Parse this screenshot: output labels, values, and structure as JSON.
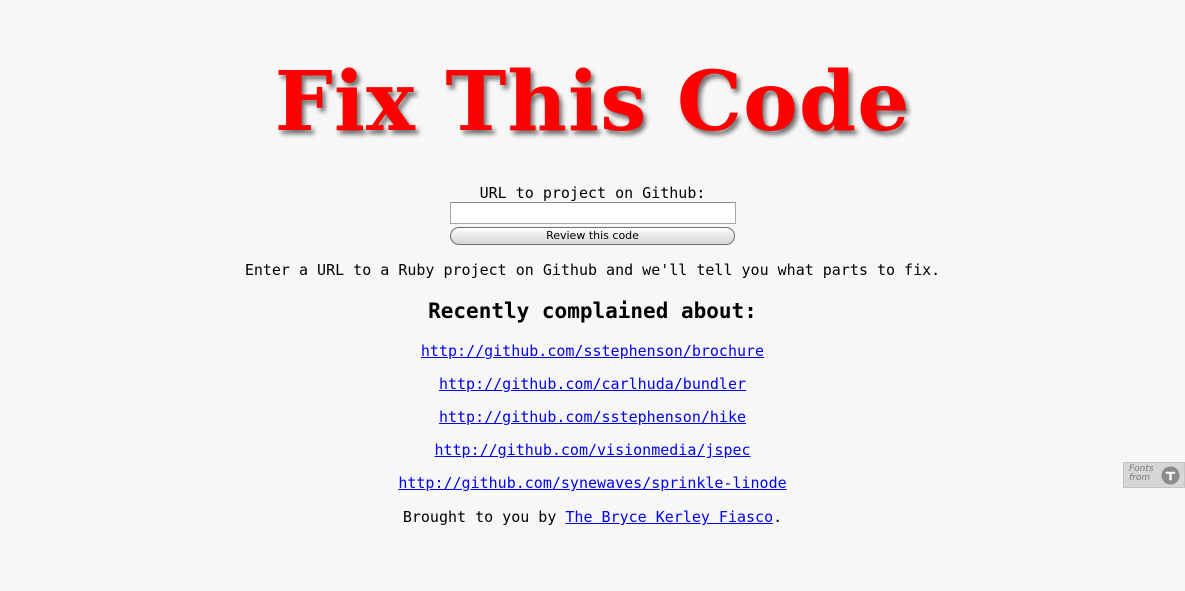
{
  "page": {
    "title": "Fix This Code"
  },
  "form": {
    "label": "URL to project on Github:",
    "input_value": "",
    "input_placeholder": "",
    "submit_label": "Review this code"
  },
  "intro": {
    "text": "Enter a URL to a Ruby project on Github and we'll tell you what parts to fix."
  },
  "recent": {
    "heading": "Recently complained about:",
    "links": [
      "http://github.com/sstephenson/brochure",
      "http://github.com/carlhuda/bundler",
      "http://github.com/sstephenson/hike",
      "http://github.com/visionmedia/jspec",
      "http://github.com/synewaves/sprinkle-linode"
    ]
  },
  "credit": {
    "prefix": "Brought to you by ",
    "link_text": "The Bryce Kerley Fiasco",
    "suffix": "."
  },
  "badge": {
    "text": "Fonts from",
    "icon": "typekit-logo-icon"
  },
  "colors": {
    "title": "#ff0000",
    "link": "#0000ee",
    "background": "#f7f7f7"
  }
}
